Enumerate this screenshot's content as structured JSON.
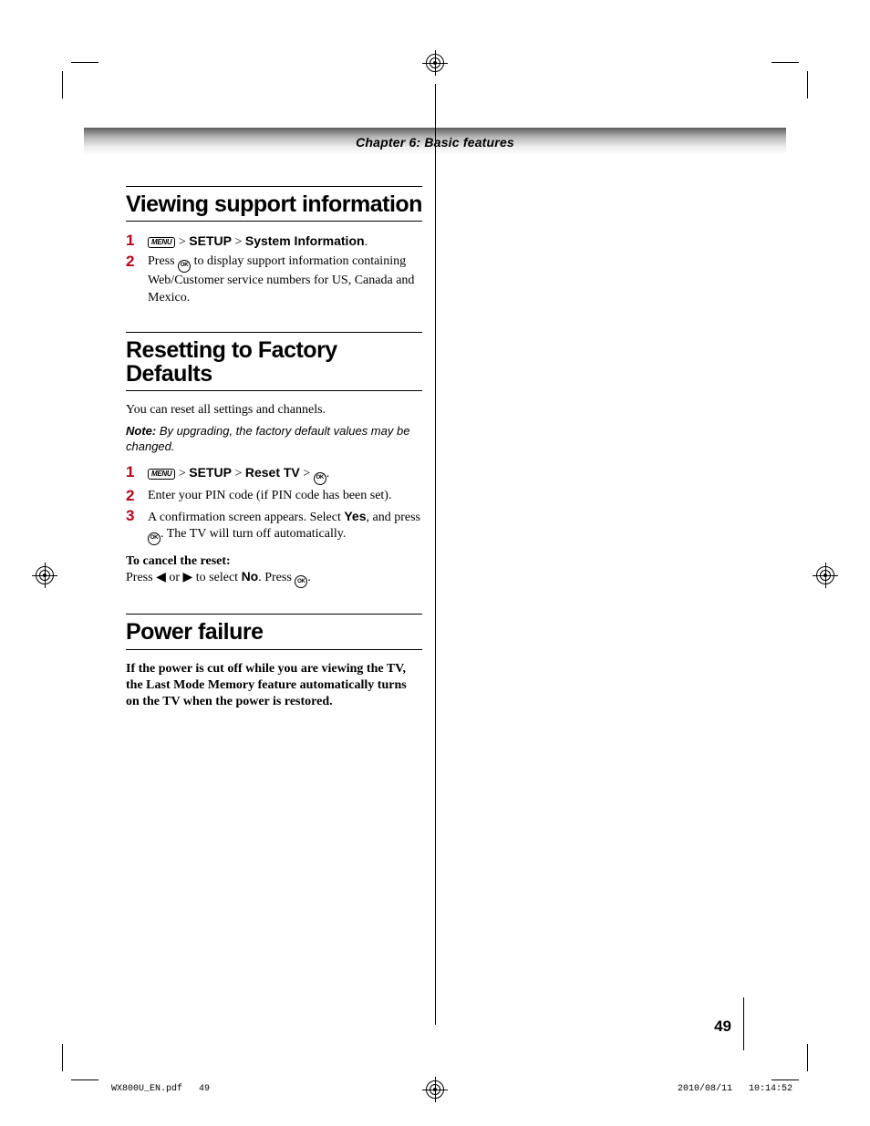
{
  "chapter_header": "Chapter 6: Basic features",
  "icons": {
    "menu_label": "MENU",
    "ok_label": "OK"
  },
  "section1": {
    "title": "Viewing support information",
    "steps": [
      {
        "n": "1",
        "setup": "SETUP",
        "gt1": " > ",
        "sys": "System Information",
        "dot": "."
      },
      {
        "n": "2",
        "pre": "Press ",
        "post": " to display support information containing Web/Customer service numbers for US, Canada and Mexico."
      }
    ]
  },
  "section2": {
    "title": "Resetting to Factory Defaults",
    "intro": "You can reset all settings and channels.",
    "note_label": "Note:",
    "note_body": " By upgrading, the factory default values may be changed.",
    "steps": [
      {
        "n": "1",
        "setup": "SETUP",
        "gt1": " > ",
        "reset": "Reset TV",
        "gt2": " > ",
        "dot": "."
      },
      {
        "n": "2",
        "txt": "Enter your PIN code (if PIN code has been set)."
      },
      {
        "n": "3",
        "pre": "A confirmation screen appears. Select ",
        "yes": "Yes",
        "mid": ", and press ",
        "post": ". The TV will turn off automatically."
      }
    ],
    "cancel_head": "To cancel the reset:",
    "cancel_pre": "Press ",
    "cancel_or": " or ",
    "cancel_mid": " to select ",
    "cancel_no": "No",
    "cancel_post1": ". Press ",
    "cancel_post2": "."
  },
  "section3": {
    "title": "Power failure",
    "body": "If the power is cut off while you are viewing the TV, the Last Mode Memory feature automatically turns on the TV when the power is restored."
  },
  "page_number": "49",
  "footer": {
    "left_file": "WX800U_EN.pdf",
    "left_page": "49",
    "right_date": "2010/08/11",
    "right_time": "10:14:52"
  }
}
